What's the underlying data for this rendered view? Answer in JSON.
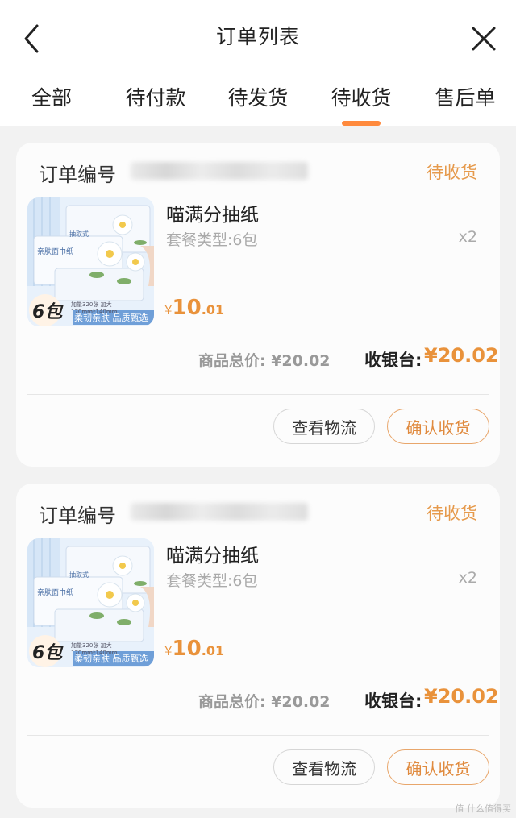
{
  "header": {
    "title": "订单列表"
  },
  "tabs": [
    {
      "label": "全部",
      "active": false
    },
    {
      "label": "待付款",
      "active": false
    },
    {
      "label": "待发货",
      "active": false
    },
    {
      "label": "待收货",
      "active": true
    },
    {
      "label": "售后单",
      "active": false
    }
  ],
  "colors": {
    "accent": "#e9923b",
    "indicator": "#ff8a3d",
    "status": "#e69a4c"
  },
  "orders": [
    {
      "order_label": "订单编号",
      "status": "待收货",
      "product": {
        "name": "喵满分抽纸",
        "spec": "套餐类型:6包",
        "qty": "x2",
        "price_symbol": "¥",
        "price_int": "10",
        "price_dec": ".01",
        "image": {
          "badge": "6包",
          "box_line1": "抽取式",
          "box_line2": "亲肤面巾纸",
          "sub": "加量320张 加大170mm*140mm",
          "banner": "柔韧亲肤 品质甄选"
        }
      },
      "subtotal": "商品总价: ¥20.02",
      "cashier_label": "收银台:",
      "cashier_value": "¥20.02",
      "buttons": {
        "logistics": "查看物流",
        "confirm": "确认收货"
      }
    },
    {
      "order_label": "订单编号",
      "status": "待收货",
      "product": {
        "name": "喵满分抽纸",
        "spec": "套餐类型:6包",
        "qty": "x2",
        "price_symbol": "¥",
        "price_int": "10",
        "price_dec": ".01",
        "image": {
          "badge": "6包",
          "box_line1": "抽取式",
          "box_line2": "亲肤面巾纸",
          "sub": "加量320张 加大170mm*140mm",
          "banner": "柔韧亲肤 品质甄选"
        }
      },
      "subtotal": "商品总价: ¥20.02",
      "cashier_label": "收银台:",
      "cashier_value": "¥20.02",
      "buttons": {
        "logistics": "查看物流",
        "confirm": "确认收货"
      }
    }
  ],
  "watermark": "值 什么值得买"
}
